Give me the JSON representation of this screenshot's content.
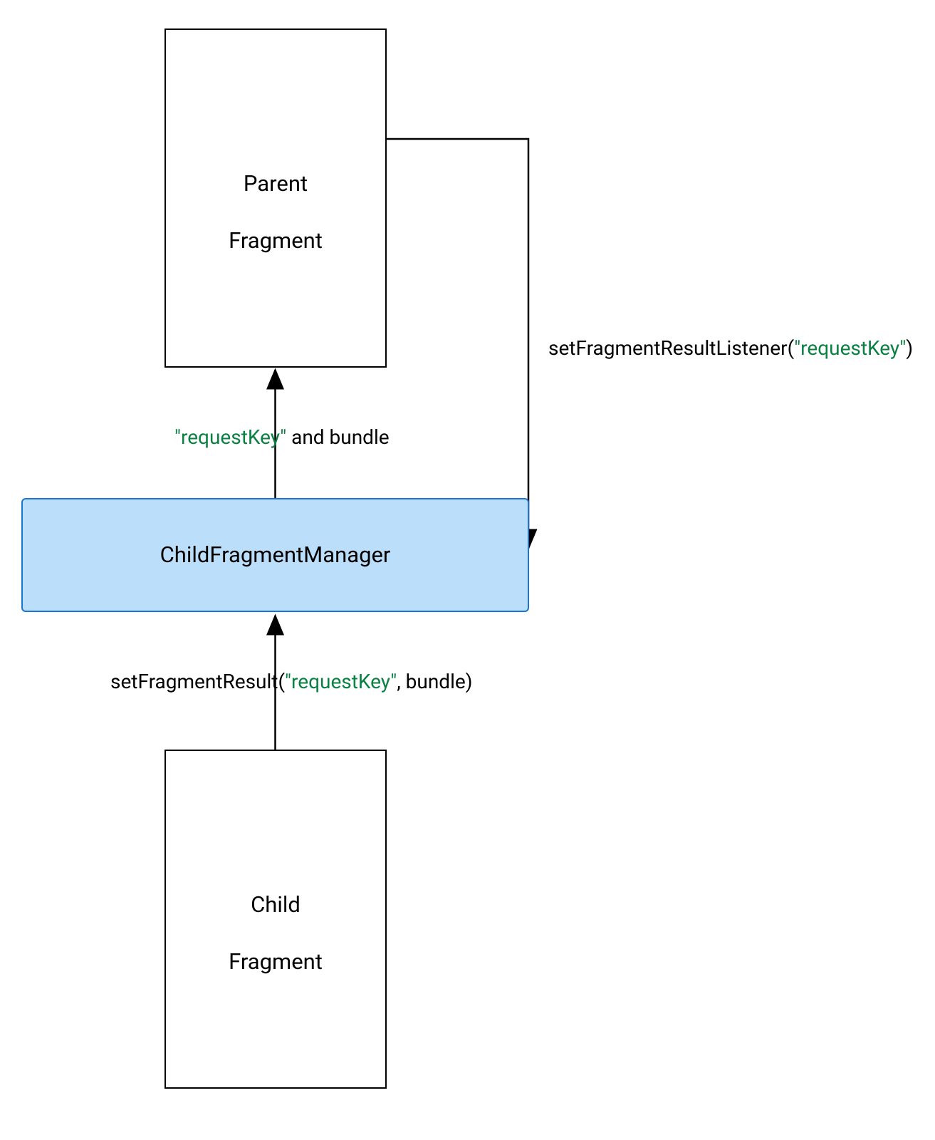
{
  "nodes": {
    "parent": {
      "line1": "Parent",
      "line2": "Fragment"
    },
    "manager": {
      "label": "ChildFragmentManager"
    },
    "child": {
      "line1": "Child",
      "line2": "Fragment"
    }
  },
  "edges": {
    "managerToParent": {
      "key": "\"requestKey\"",
      "suffix": " and bundle"
    },
    "parentToManager": {
      "prefix": "setFragmentResultListener(",
      "key": "\"requestKey\"",
      "suffix": ")"
    },
    "childToManager": {
      "prefix": "setFragmentResult(",
      "key": "\"requestKey\"",
      "suffix": ", bundle)"
    }
  }
}
